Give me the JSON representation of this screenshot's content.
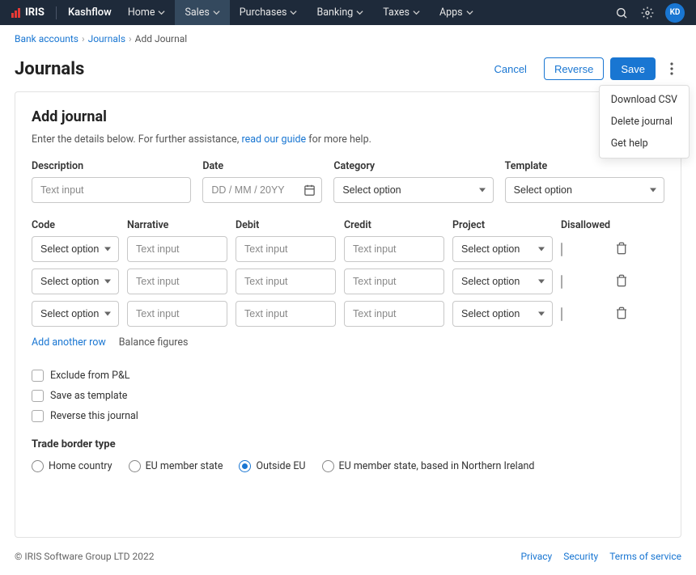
{
  "brand": {
    "name": "IRIS",
    "product": "Kashflow"
  },
  "nav": {
    "items": [
      {
        "label": "Home"
      },
      {
        "label": "Sales"
      },
      {
        "label": "Purchases"
      },
      {
        "label": "Banking"
      },
      {
        "label": "Taxes"
      },
      {
        "label": "Apps"
      }
    ],
    "activeIndex": 1,
    "avatar": "KD"
  },
  "breadcrumb": {
    "items": [
      {
        "label": "Bank accounts",
        "link": true
      },
      {
        "label": "Journals",
        "link": true
      },
      {
        "label": "Add Journal",
        "link": false
      }
    ]
  },
  "page": {
    "title": "Journals"
  },
  "actions": {
    "cancel": "Cancel",
    "reverse": "Reverse",
    "save": "Save"
  },
  "menu": {
    "items": [
      "Download CSV",
      "Delete journal",
      "Get help"
    ]
  },
  "card": {
    "title": "Add journal",
    "subPrefix": "Enter the details below. For further assistance, ",
    "subLink": "read our guide",
    "subSuffix": " for more help."
  },
  "fields": {
    "description": {
      "label": "Description",
      "placeholder": "Text input"
    },
    "date": {
      "label": "Date",
      "placeholder": "DD / MM / 20YY"
    },
    "category": {
      "label": "Category",
      "placeholder": "Select option"
    },
    "template": {
      "label": "Template",
      "placeholder": "Select option"
    }
  },
  "grid": {
    "headers": {
      "code": "Code",
      "narrative": "Narrative",
      "debit": "Debit",
      "credit": "Credit",
      "project": "Project",
      "disallowed": "Disallowed"
    },
    "rowPlaceholders": {
      "select": "Select option",
      "text": "Text input"
    },
    "rowCount": 3
  },
  "links": {
    "add": "Add another row",
    "balance": "Balance figures"
  },
  "checks": {
    "exclude": "Exclude from P&L",
    "saveTemplate": "Save as template",
    "reverse": "Reverse this journal"
  },
  "tradeBorder": {
    "label": "Trade border type",
    "options": [
      "Home country",
      "EU member state",
      "Outside EU",
      "EU member state, based in Northern Ireland"
    ],
    "selectedIndex": 2
  },
  "footer": {
    "copyright": "© IRIS Software Group LTD 2022",
    "links": [
      "Privacy",
      "Security",
      "Terms of service"
    ]
  }
}
